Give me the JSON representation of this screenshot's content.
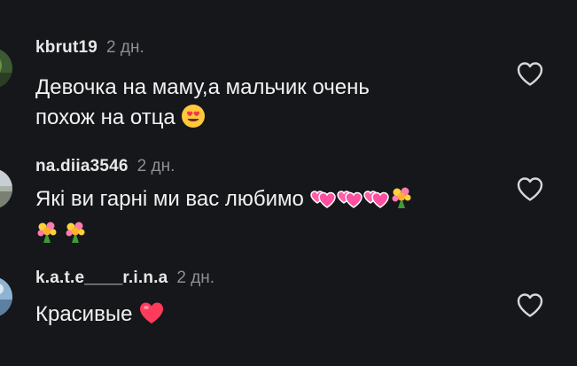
{
  "comments": [
    {
      "username": "kbrut19",
      "time": "2 дн.",
      "text_line1": "Девочка на маму,а  мальчик очень",
      "text_line2": "похож на отца",
      "emoji": "heart-eyes-icon"
    },
    {
      "username": "na.diia3546",
      "time": "2 дн.",
      "text_line1": "Які ви гарні ми вас любимо",
      "emoji": [
        "two-hearts-icon",
        "two-hearts-icon",
        "two-hearts-icon",
        "bouquet-icon",
        "bouquet-icon",
        "bouquet-icon"
      ]
    },
    {
      "username": "k.a.t.e____r.i.n.a",
      "time": "2 дн.",
      "text_line1": "Красивые",
      "emoji": "red-heart-icon"
    }
  ],
  "colors": {
    "background": "#15171a",
    "text": "#f2f2f2",
    "secondary": "#8e8e93",
    "like_icon": "#d8d8d8"
  }
}
